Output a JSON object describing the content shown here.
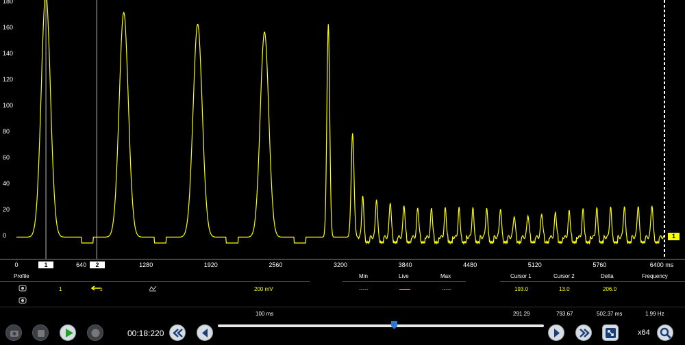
{
  "chart_data": {
    "type": "line",
    "ylim": [
      -15,
      180
    ],
    "xlim": [
      0,
      6400
    ],
    "yticks": [
      "180",
      "160",
      "140",
      "120",
      "100",
      "80",
      "60",
      "40",
      "20",
      "0"
    ],
    "xticks": [
      "0",
      "640",
      "1280",
      "1920",
      "2560",
      "3200",
      "3840",
      "4480",
      "5120",
      "5760",
      "6400 ms"
    ],
    "series_color": "#ffff00",
    "channel_tag": "1",
    "peaks": [
      {
        "x": 290,
        "y": 180
      },
      {
        "x": 1060,
        "y": 167
      },
      {
        "x": 1790,
        "y": 158
      },
      {
        "x": 2450,
        "y": 152
      },
      {
        "x": 3080,
        "y": 158
      },
      {
        "x": 3320,
        "y": 74
      },
      {
        "x": 3500,
        "y": 35
      },
      {
        "x": 3650,
        "y": 25
      },
      {
        "x": 3800,
        "y": 20
      },
      {
        "x": 6400,
        "y": 22
      }
    ]
  },
  "cursors": {
    "cursor1_tag": "1",
    "cursor2_tag": "2"
  },
  "info": {
    "profile_label": "Profile",
    "channel_num": "1",
    "scale": "200 mV",
    "timebase": "100 ms",
    "min_label": "Min",
    "live_label": "Live",
    "max_label": "Max",
    "min_val": "-----",
    "max_val": "-----",
    "cursor1_label": "Cursor 1",
    "cursor2_label": "Cursor 2",
    "delta_label": "Delta",
    "frequency_label": "Frequency",
    "cursor1_val": "193.0",
    "cursor2_val": "13.0",
    "delta_val": "206.0",
    "cursor1_time": "291.29",
    "cursor2_time": "793.67",
    "delta_time": "502.37 ms",
    "frequency_val": "1.99 Hz"
  },
  "toolbar": {
    "time": "00:18:220",
    "zoom": "x64",
    "slider_position": 0.54
  }
}
